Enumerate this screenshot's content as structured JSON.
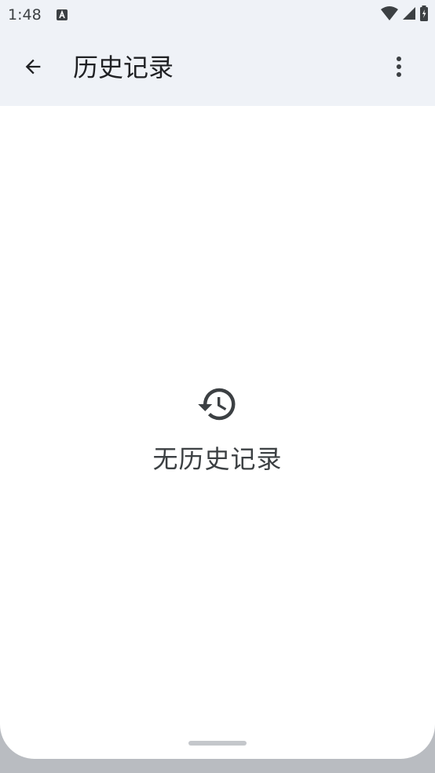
{
  "status_bar": {
    "time": "1:48",
    "notification_icon": "a-box-icon",
    "wifi_icon": "wifi-icon",
    "signal_icon": "cell-signal-icon",
    "battery_icon": "battery-charging-icon"
  },
  "app_bar": {
    "back_icon": "arrow-back-icon",
    "title": "历史记录",
    "menu_icon": "more-vert-icon"
  },
  "empty_state": {
    "icon": "history-icon",
    "message": "无历史记录"
  },
  "colors": {
    "app_bar_bg": "#eff2f7",
    "text_primary": "#202124",
    "text_secondary": "#3c4043",
    "icon": "#3c4043"
  }
}
